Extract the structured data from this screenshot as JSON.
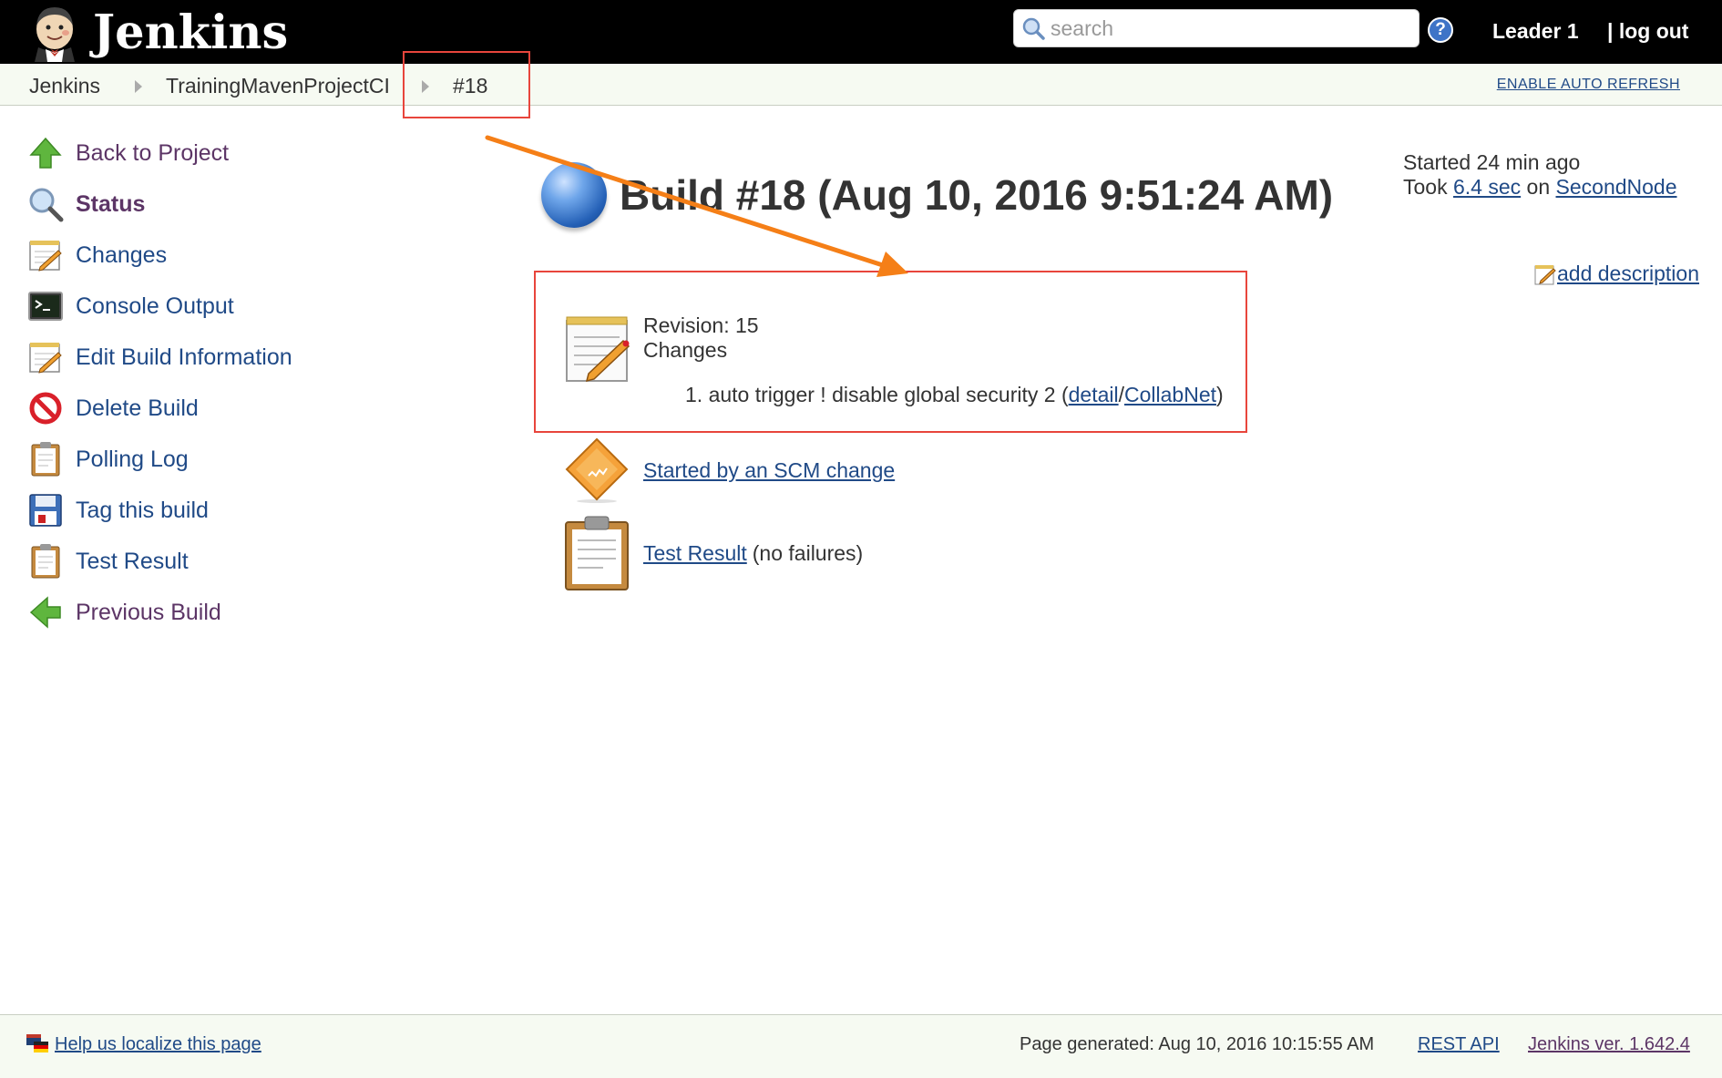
{
  "header": {
    "app_title": "Jenkins",
    "search_placeholder": "search",
    "help_label": "?",
    "user_name": "Leader 1",
    "logout_label": "| log out"
  },
  "breadcrumb": {
    "items": [
      "Jenkins",
      "TrainingMavenProjectCI",
      "#18"
    ],
    "auto_refresh_label": "ENABLE AUTO REFRESH"
  },
  "side_panel": {
    "tasks": [
      {
        "label": "Back to Project",
        "icon": "up-arrow-icon"
      },
      {
        "label": "Status",
        "icon": "magnifier-icon"
      },
      {
        "label": "Changes",
        "icon": "notepad-icon"
      },
      {
        "label": "Console Output",
        "icon": "terminal-icon"
      },
      {
        "label": "Edit Build Information",
        "icon": "notepad-icon"
      },
      {
        "label": "Delete Build",
        "icon": "no-entry-icon"
      },
      {
        "label": "Polling Log",
        "icon": "clipboard-icon"
      },
      {
        "label": "Tag this build",
        "icon": "floppy-disk-icon"
      },
      {
        "label": "Test Result",
        "icon": "clipboard-icon"
      },
      {
        "label": "Previous Build",
        "icon": "left-arrow-icon"
      }
    ]
  },
  "build": {
    "title": "Build #18 (Aug 10, 2016 9:51:24 AM)",
    "status_color": "#2460b6",
    "started_ago": "Started 24 min ago",
    "took_prefix": "Took ",
    "duration": "6.4 sec",
    "on_label": " on ",
    "node": "SecondNode",
    "add_description_label": "add description"
  },
  "changes": {
    "revision": "Revision: 15",
    "heading": "Changes",
    "item_text": "1. auto trigger ! disable global security 2 (",
    "detail_link": "detail",
    "slash": "/",
    "collabnet_link": "CollabNet",
    "close_paren": ")"
  },
  "cause": {
    "label": "Started by an SCM change"
  },
  "test_result": {
    "link": "Test Result",
    "summary": "(no failures)"
  },
  "footer": {
    "localize_label": "Help us localize this page",
    "page_generated": "Page generated: Aug 10, 2016 10:15:55 AM",
    "rest_api_label": "REST API",
    "version_label": "Jenkins ver. 1.642.4"
  },
  "annotation_color": "#e8453c",
  "arrow_color": "#f57f17"
}
